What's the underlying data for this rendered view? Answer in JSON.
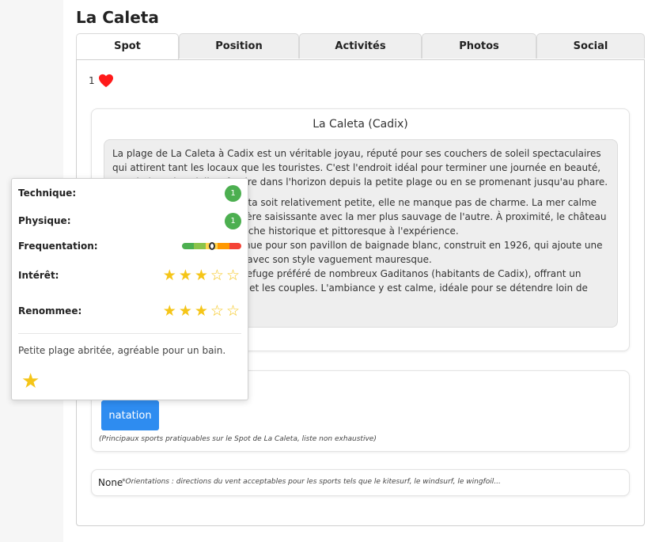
{
  "page": {
    "title": "La Caleta"
  },
  "tabs": [
    {
      "label": "Spot",
      "active": true
    },
    {
      "label": "Position",
      "active": false
    },
    {
      "label": "Activités",
      "active": false
    },
    {
      "label": "Photos",
      "active": false
    },
    {
      "label": "Social",
      "active": false
    }
  ],
  "likes": {
    "count": "1",
    "icon": "heart-icon",
    "color": "#ff1a1a"
  },
  "description": {
    "title": "La Caleta (Cadix)",
    "paragraphs": [
      "La plage de La Caleta à Cadix est un véritable joyau, réputé pour ses couchers de soleil spectaculaires qui attirent tant les locaux que les touristes. C'est l'endroit idéal pour terminer une journée en beauté, en admirant le soleil se fondre dans l'horizon depuis la petite plage ou en se promenant jusqu'au phare.",
      "Bien que la plage de La Caleta soit relativement petite, elle ne manque pas de charme. La mer calme d'un côté contraste de manière saisissante avec la mer plus sauvage de l'autre. À proximité, le château de San Felipe ajoute une touche historique et pittoresque à l'expérience.\nLa plage est également connue pour son pavillon de baignade blanc, construit en 1926, qui ajoute une touche unique à l'ensemble avec son style vaguement mauresque.\nLa Caleta est également le refuge préféré de nombreux Gaditanos (habitants de Cadix), offrant un cadre idéal pour les familles et les couples. L'ambiance y est calme, idéale pour se détendre loin de l'agitation de la ville."
    ]
  },
  "sports": {
    "items": [
      "natation"
    ],
    "note": "(Principaux sports pratiquables sur le Spot de La Caleta, liste non exhaustive)"
  },
  "orientations": {
    "value": "None",
    "note": "*Orientations : directions du vent acceptables pour les sports tels que le kitesurf, le windsurf, le wingfoil..."
  },
  "popup": {
    "technique": {
      "label": "Technique:",
      "value": "1"
    },
    "physique": {
      "label": "Physique:",
      "value": "1"
    },
    "frequentation": {
      "label": "Frequentation:",
      "level": 0.5
    },
    "interet": {
      "label": "Intérêt:",
      "rating": 3,
      "max": 5
    },
    "renommee": {
      "label": "Renommee:",
      "rating": 3,
      "max": 5
    },
    "description": "Petite plage abritée, agréable pour un bain.",
    "favorite_icon": "star-icon"
  },
  "colors": {
    "accent": "#2e8cf0",
    "badge": "#4caf50",
    "star": "#f5c518"
  }
}
